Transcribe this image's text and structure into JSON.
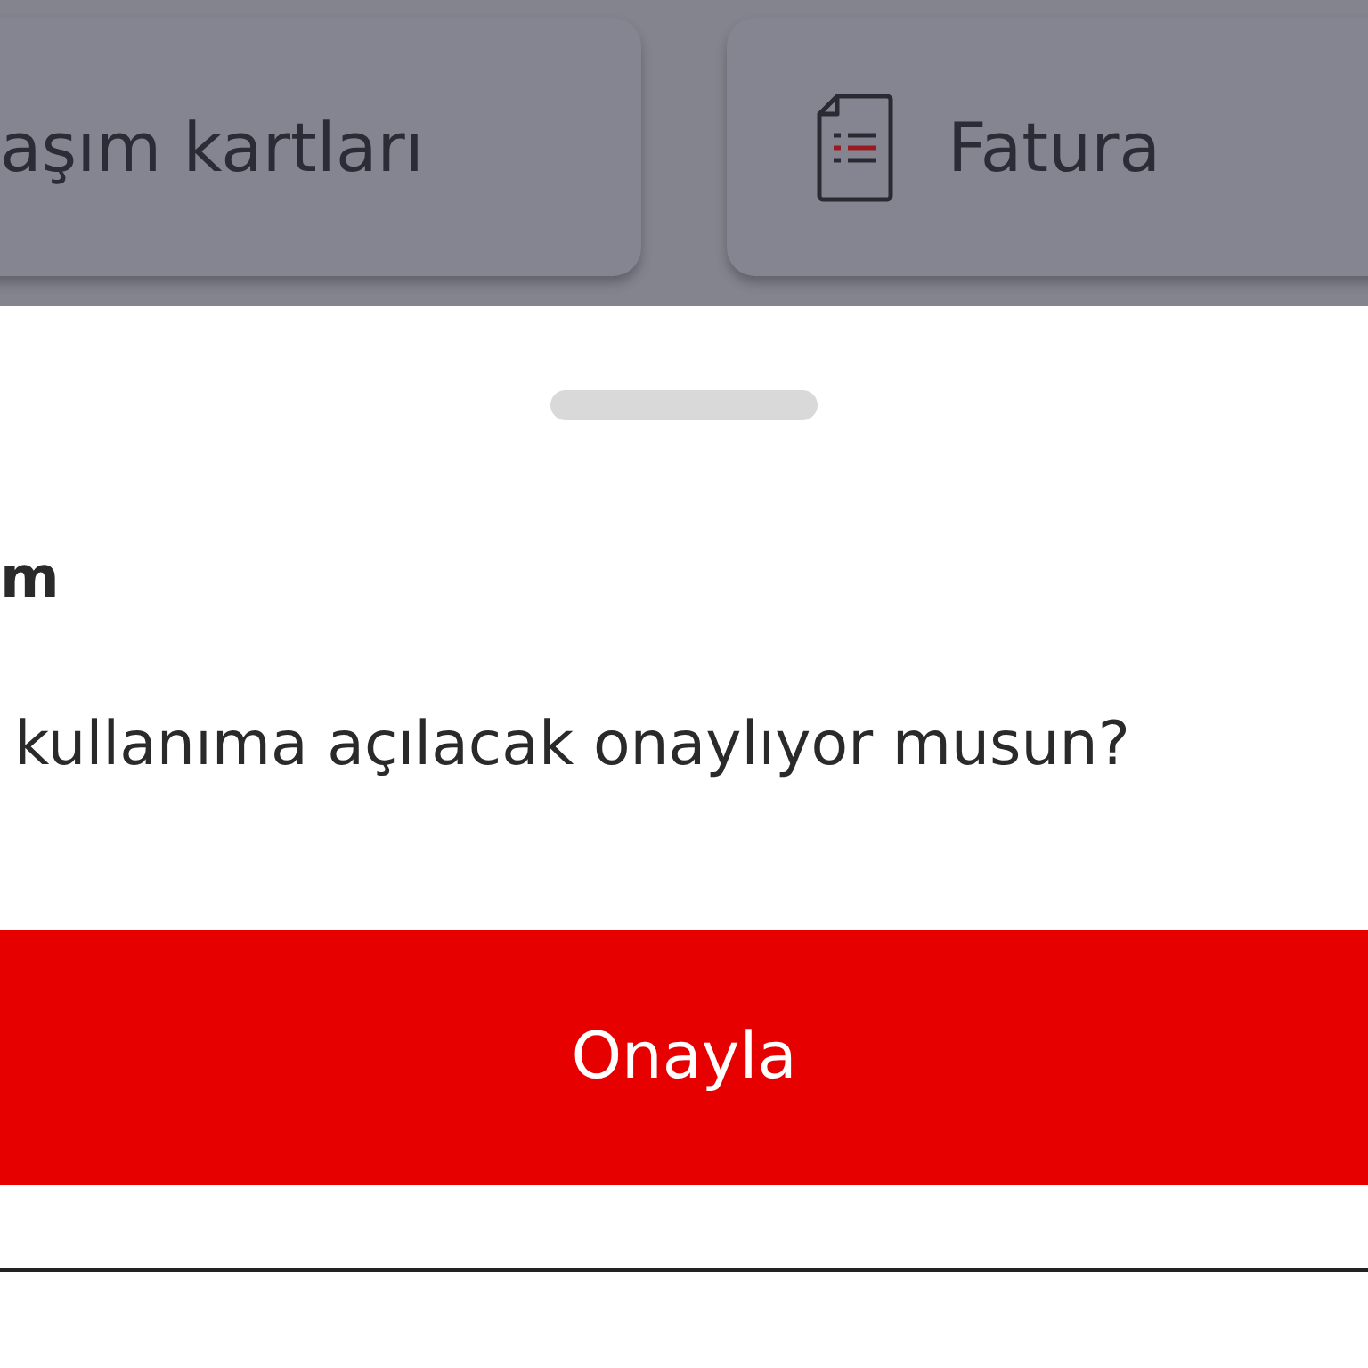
{
  "shortcuts": [
    {
      "label": "aşım kartları",
      "kind": "plain"
    },
    {
      "label": "Fatura",
      "kind": "invoice"
    }
  ],
  "sheet": {
    "title": "m",
    "message": "kullanıma açılacak onaylıyor musun?",
    "confirm_button": "Onayla"
  }
}
